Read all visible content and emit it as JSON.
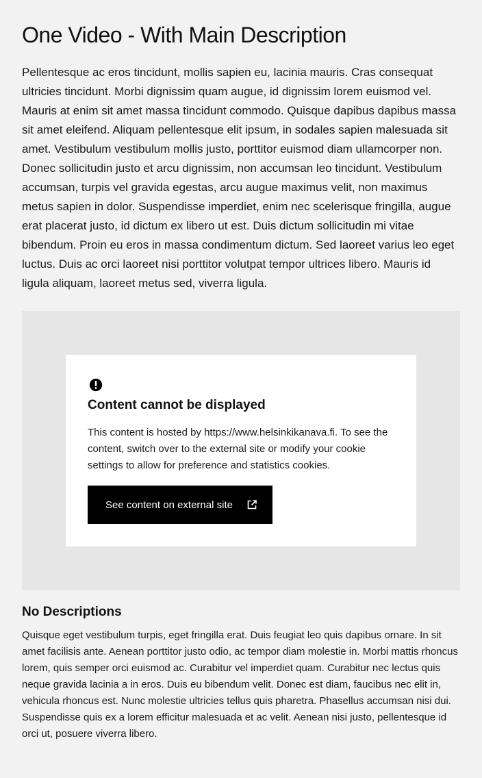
{
  "page": {
    "title": "One Video - With Main Description",
    "main_description": "Pellentesque ac eros tincidunt, mollis sapien eu, lacinia mauris. Cras consequat ultricies tincidunt. Morbi dignissim quam augue, id dignissim lorem euismod vel. Mauris at enim sit amet massa tincidunt commodo. Quisque dapibus dapibus massa sit amet eleifend. Aliquam pellentesque elit ipsum, in sodales sapien malesuada sit amet. Vestibulum vestibulum mollis justo, porttitor euismod diam ullamcorper non. Donec sollicitudin justo et arcu dignissim, non accumsan leo tincidunt. Vestibulum accumsan, turpis vel gravida egestas, arcu augue maximus velit, non maximus metus sapien in dolor. Suspendisse imperdiet, enim nec scelerisque fringilla, augue erat placerat justo, id dictum ex libero ut est. Duis dictum sollicitudin mi vitae bibendum. Proin eu eros in massa condimentum dictum. Sed laoreet varius leo eget luctus. Duis ac orci laoreet nisi porttitor volutpat tempor ultrices libero. Mauris id ligula aliquam, laoreet metus sed, viverra ligula."
  },
  "embed_notice": {
    "icon": "alert-circle-icon",
    "title": "Content cannot be displayed",
    "text": "This content is hosted by https://www.helsinkikanava.fi. To see the content, switch over to the external site or modify your cookie settings to allow for preference and statistics cookies.",
    "button_label": "See content on external site",
    "button_icon": "external-link-icon"
  },
  "section": {
    "heading": "No Descriptions",
    "text": "Quisque eget vestibulum turpis, eget fringilla erat. Duis feugiat leo quis dapibus ornare. In sit amet facilisis ante. Aenean porttitor justo odio, ac tempor diam molestie in. Morbi mattis rhoncus lorem, quis semper orci euismod ac. Curabitur vel imperdiet quam. Curabitur nec lectus quis neque gravida lacinia a in eros. Duis eu bibendum velit. Donec est diam, faucibus nec elit in, vehicula rhoncus est. Nunc molestie ultricies tellus quis pharetra. Phasellus accumsan nisi dui. Suspendisse quis ex a lorem efficitur malesuada et ac velit. Aenean nisi justo, pellentesque id orci ut, posuere viverra libero."
  },
  "colors": {
    "background": "#f2f2f2",
    "embed_background": "#e6e6e6",
    "card_background": "#ffffff",
    "button_background": "#000000",
    "button_text": "#ffffff"
  }
}
